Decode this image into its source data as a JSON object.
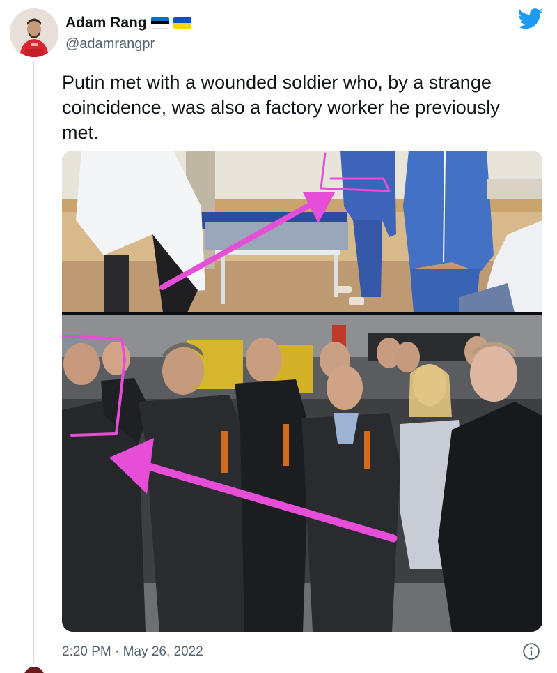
{
  "tweet": {
    "author": {
      "display_name": "Adam Rang",
      "handle": "@adamrangpr",
      "flags": [
        "estonia-flag",
        "ukraine-flag"
      ]
    },
    "text": "Putin met with a wounded soldier who, by a strange coincidence, was also a factory worker he previously met.",
    "timestamp": "2:20 PM · May 26, 2022",
    "icons": [
      "twitter-bird-icon",
      "info-icon"
    ],
    "media": {
      "description_panels": [
        "hospital-ward-photo",
        "factory-group-photo"
      ],
      "annotation_color": "#e64ed8"
    }
  },
  "colors": {
    "twitter_blue": "#1d9bf0",
    "text_primary": "#0f1419",
    "text_secondary": "#536471",
    "thread_line": "#cfd9de",
    "annotation_pink": "#e64ed8"
  }
}
